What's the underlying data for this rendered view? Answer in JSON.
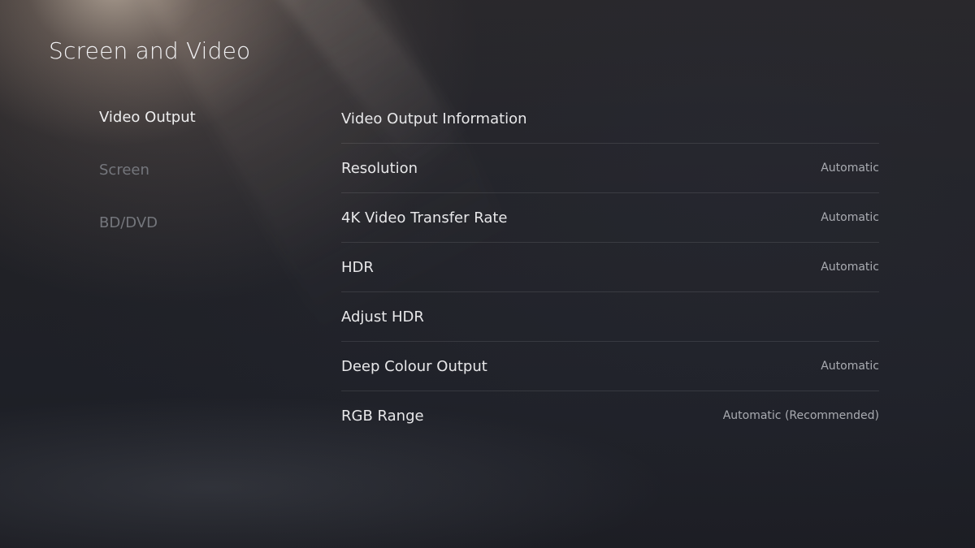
{
  "page": {
    "title": "Screen and Video"
  },
  "sidebar": {
    "items": [
      {
        "label": "Video Output",
        "active": true
      },
      {
        "label": "Screen",
        "active": false
      },
      {
        "label": "BD/DVD",
        "active": false
      }
    ]
  },
  "settings": {
    "rows": [
      {
        "label": "Video Output Information",
        "value": ""
      },
      {
        "label": "Resolution",
        "value": "Automatic"
      },
      {
        "label": "4K Video Transfer Rate",
        "value": "Automatic"
      },
      {
        "label": "HDR",
        "value": "Automatic"
      },
      {
        "label": "Adjust HDR",
        "value": ""
      },
      {
        "label": "Deep Colour Output",
        "value": "Automatic"
      },
      {
        "label": "RGB Range",
        "value": "Automatic (Recommended)"
      }
    ]
  },
  "colors": {
    "text_primary": "#eeeeef",
    "text_inactive": "#74767c",
    "text_value": "#a9abb1",
    "background": "#1c1d22"
  }
}
